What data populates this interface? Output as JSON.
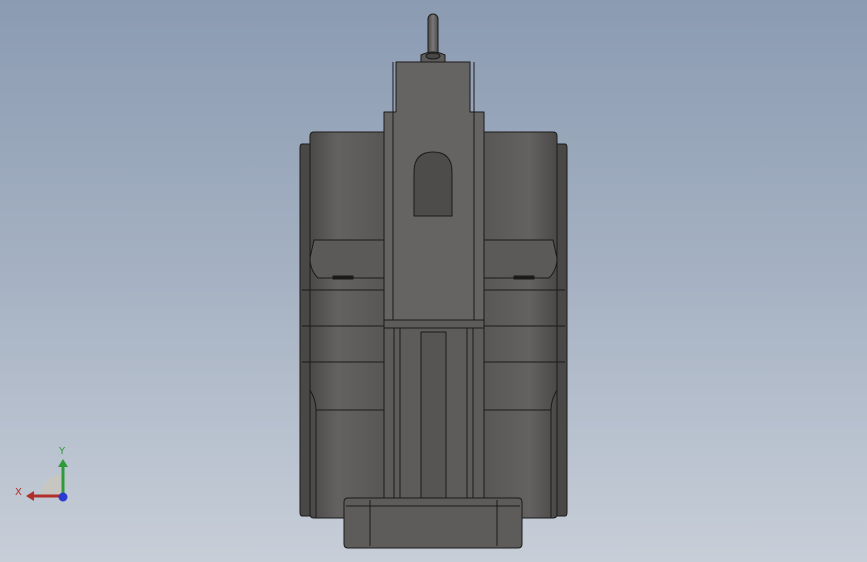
{
  "viewport": {
    "background_top": "#8b9bb2",
    "background_bottom": "#c7ced8"
  },
  "model": {
    "body_color": "#5a5856",
    "dark_color": "#4a4846",
    "edge_color": "#1a1a1a",
    "slot_color": "#3a3837"
  },
  "triad": {
    "x_label": "X",
    "y_label": "Y",
    "x_color": "#b0302a",
    "y_color": "#2e9a3a",
    "z_color": "#2a3ad0"
  }
}
